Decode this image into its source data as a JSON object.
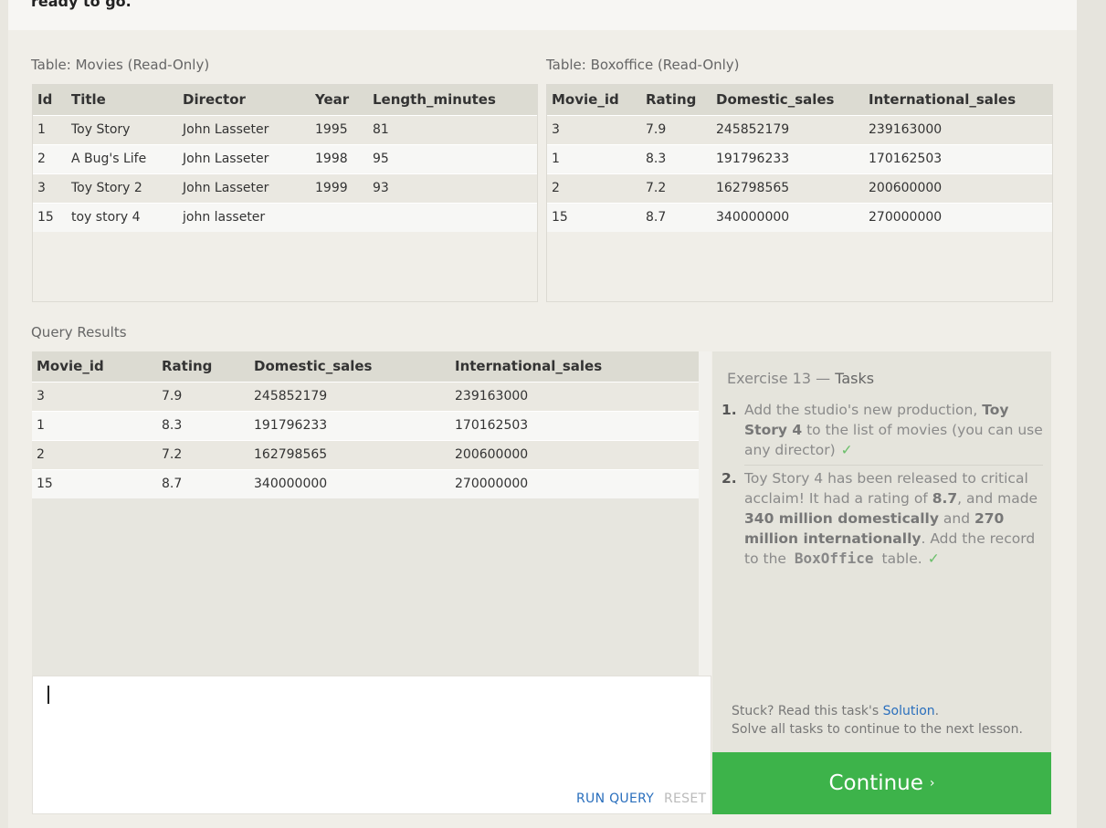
{
  "intro": {
    "text": "ready to go."
  },
  "movies_table": {
    "label": "Table: Movies (Read-Only)",
    "columns": [
      "Id",
      "Title",
      "Director",
      "Year",
      "Length_minutes"
    ],
    "rows": [
      [
        "1",
        "Toy Story",
        "John Lasseter",
        "1995",
        "81"
      ],
      [
        "2",
        "A Bug's Life",
        "John Lasseter",
        "1998",
        "95"
      ],
      [
        "3",
        "Toy Story 2",
        "John Lasseter",
        "1999",
        "93"
      ],
      [
        "15",
        "toy story 4",
        "john lasseter",
        "",
        ""
      ]
    ]
  },
  "boxoffice_table": {
    "label": "Table: Boxoffice (Read-Only)",
    "columns": [
      "Movie_id",
      "Rating",
      "Domestic_sales",
      "International_sales"
    ],
    "rows": [
      [
        "3",
        "7.9",
        "245852179",
        "239163000"
      ],
      [
        "1",
        "8.3",
        "191796233",
        "170162503"
      ],
      [
        "2",
        "7.2",
        "162798565",
        "200600000"
      ],
      [
        "15",
        "8.7",
        "340000000",
        "270000000"
      ]
    ]
  },
  "results": {
    "label": "Query Results",
    "columns": [
      "Movie_id",
      "Rating",
      "Domestic_sales",
      "International_sales"
    ],
    "rows": [
      [
        "3",
        "7.9",
        "245852179",
        "239163000"
      ],
      [
        "1",
        "8.3",
        "191796233",
        "170162503"
      ],
      [
        "2",
        "7.2",
        "162798565",
        "200600000"
      ],
      [
        "15",
        "8.7",
        "340000000",
        "270000000"
      ]
    ]
  },
  "editor": {
    "value": "",
    "run_label": "RUN QUERY",
    "reset_label": "RESET"
  },
  "tasks": {
    "title_prefix": "Exercise 13 — ",
    "title_strong": "Tasks",
    "items": [
      {
        "number": "1.",
        "text_a": "Add the studio's new production, ",
        "bold_a": "Toy Story 4",
        "text_b": " to the list of movies (you can use any director)",
        "check": "✓"
      },
      {
        "number": "2.",
        "text_a": "Toy Story 4 has been released to critical acclaim! It had a rating of ",
        "bold_a": "8.7",
        "text_b": ", and made ",
        "bold_b": "340 million domestically",
        "text_c": " and ",
        "bold_c": "270 million internationally",
        "text_d": ". Add the record to the ",
        "code": "BoxOffice",
        "text_e": " table.",
        "check": "✓"
      }
    ],
    "stuck_prefix": "Stuck? Read this task's ",
    "stuck_link": "Solution",
    "stuck_suffix": ".",
    "solve_all": "Solve all tasks to continue to the next lesson."
  },
  "continue": {
    "label": "Continue",
    "arrow": "›"
  }
}
